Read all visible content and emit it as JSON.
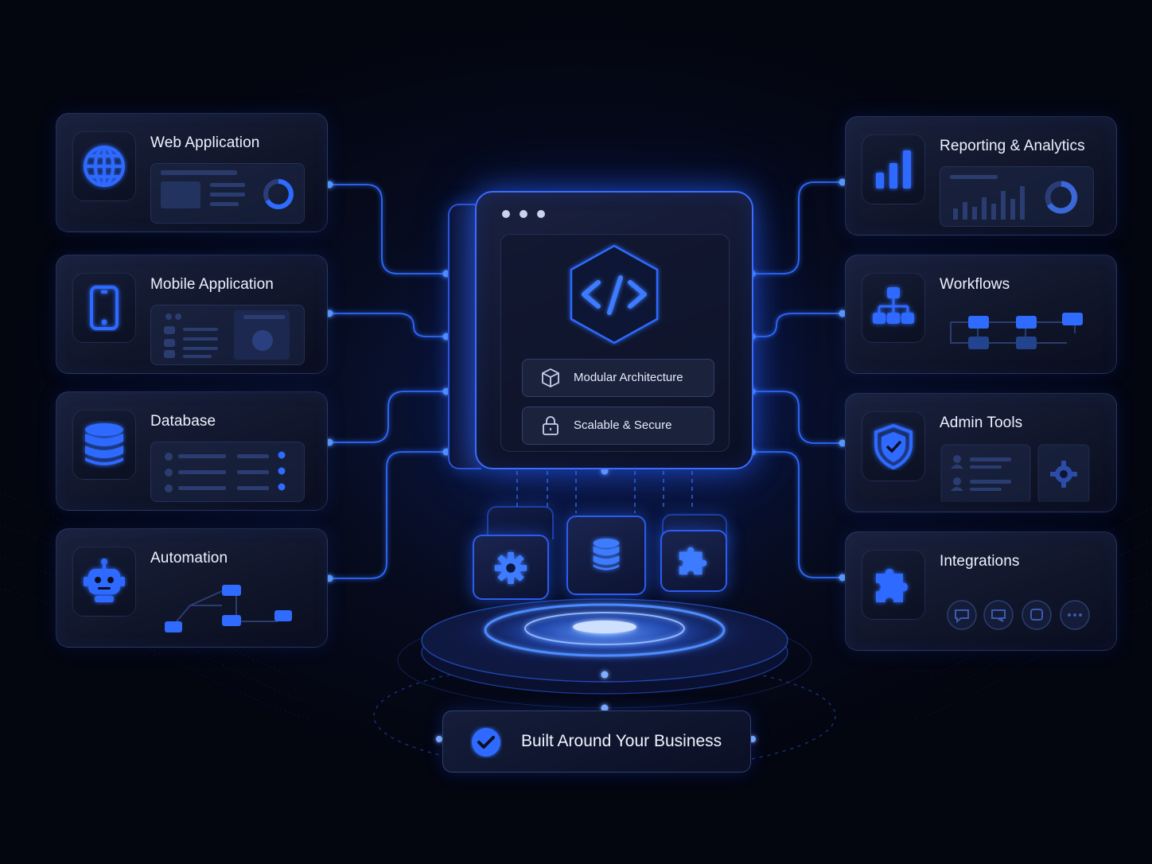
{
  "left_modules": [
    {
      "title": "Web Application",
      "icon": "globe-icon"
    },
    {
      "title": "Mobile Application",
      "icon": "smartphone-icon"
    },
    {
      "title": "Database",
      "icon": "database-icon"
    },
    {
      "title": "Automation",
      "icon": "robot-icon"
    }
  ],
  "right_modules": [
    {
      "title": "Reporting & Analytics",
      "icon": "bar-chart-icon"
    },
    {
      "title": "Workflows",
      "icon": "flowchart-icon"
    },
    {
      "title": "Admin Tools",
      "icon": "shield-icon"
    },
    {
      "title": "Integrations",
      "icon": "puzzle-icon"
    }
  ],
  "center": {
    "icon": "code-icon",
    "features": [
      {
        "label": "Modular Architecture",
        "icon": "cube-icon"
      },
      {
        "label": "Scalable & Secure",
        "icon": "lock-icon"
      }
    ]
  },
  "building_blocks": [
    "gear-icon",
    "database-icon",
    "puzzle-icon"
  ],
  "footer": {
    "label": "Built Around Your Business",
    "icon": "check-icon"
  },
  "colors": {
    "accent": "#2f6bff",
    "glow": "#3d7cff",
    "background": "#03050f",
    "text": "#eef2ff"
  }
}
